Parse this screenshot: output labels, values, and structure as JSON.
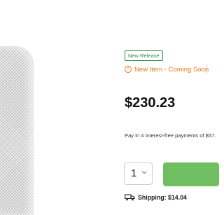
{
  "product": {
    "badge": "New Release",
    "status": "New Item - Coming Soon",
    "price": "$230.23",
    "installments": "Pay in 4 interest-free payments of $57.",
    "quantity": "1",
    "shipping": "Shipping: $14.04"
  },
  "icons": {
    "status": "info-icon",
    "quantity": "chevron-down-icon",
    "shipping": "truck-icon"
  },
  "colors": {
    "badge": "#2f8a3c",
    "status": "#e07b17",
    "button": "#6fbf62"
  }
}
